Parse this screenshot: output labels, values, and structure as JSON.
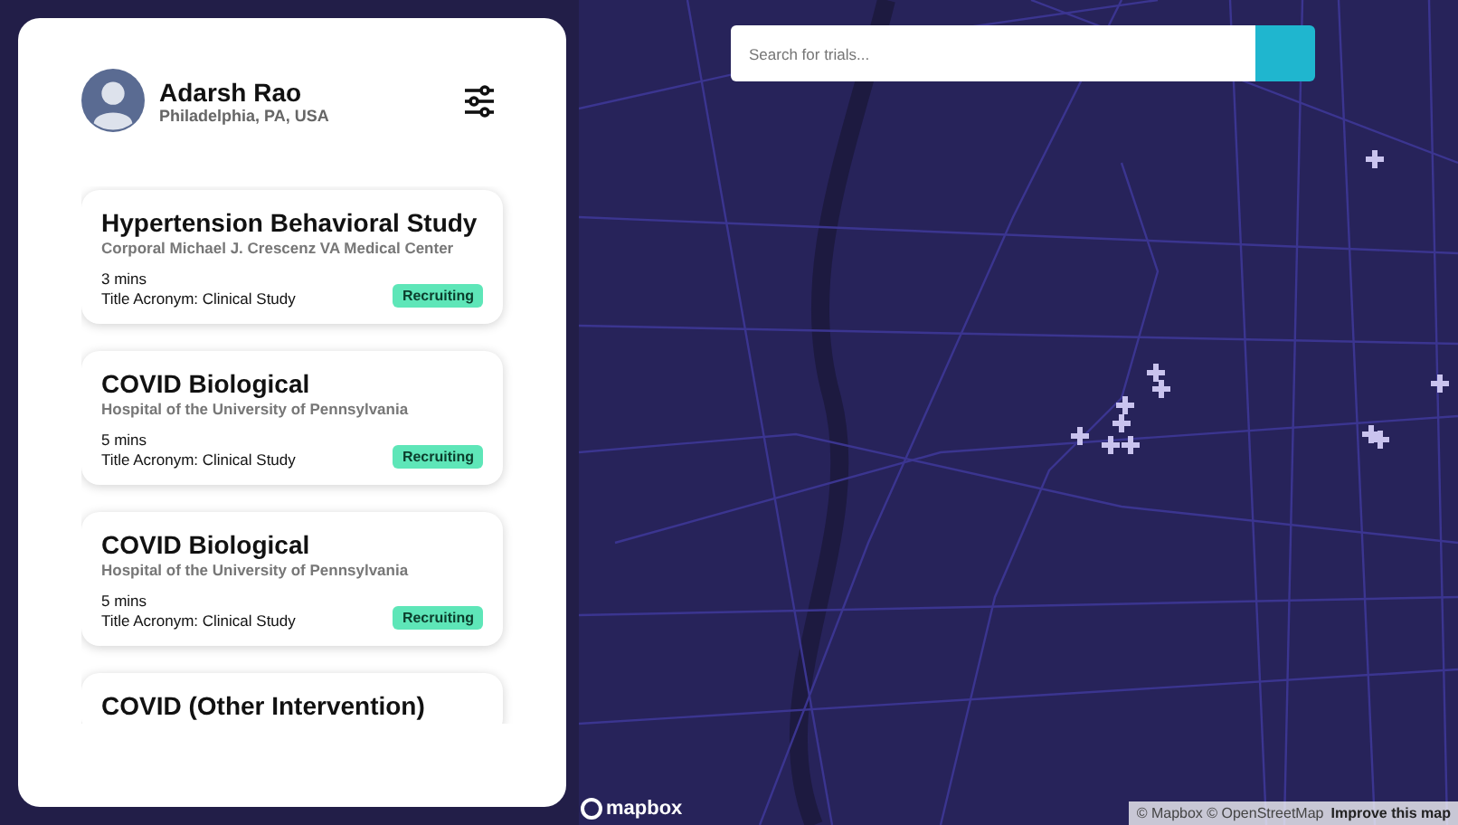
{
  "profile": {
    "name": "Adarsh Rao",
    "location": "Philadelphia, PA, USA"
  },
  "trials": [
    {
      "title": "Hypertension Behavioral Study",
      "site": "Corporal Michael J. Crescenz VA Medical Center",
      "duration": "3 mins",
      "acronym": "Title Acronym: Clinical Study",
      "status": "Recruiting"
    },
    {
      "title": "COVID Biological",
      "site": "Hospital of the University of Pennsylvania",
      "duration": "5 mins",
      "acronym": "Title Acronym: Clinical Study",
      "status": "Recruiting"
    },
    {
      "title": "COVID Biological",
      "site": "Hospital of the University of Pennsylvania",
      "duration": "5 mins",
      "acronym": "Title Acronym: Clinical Study",
      "status": "Recruiting"
    },
    {
      "title": "COVID (Other Intervention)"
    }
  ],
  "search": {
    "placeholder": "Search for trials..."
  },
  "map": {
    "logo": "mapbox",
    "attribution": "© Mapbox © OpenStreetMap",
    "improve_link": "Improve this map"
  }
}
